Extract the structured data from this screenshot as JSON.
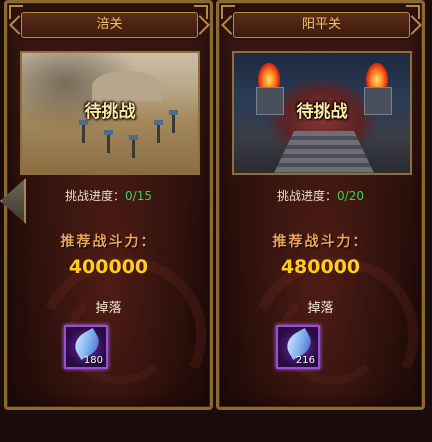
{
  "stages": [
    {
      "title": "涪关",
      "status_label": "待挑战",
      "progress_label": "挑战进度：",
      "progress_value": "0/15",
      "power_label": "推荐战斗力：",
      "power_value": "400000",
      "drop_label": "掉落",
      "drop_item": {
        "icon": "feather-icon",
        "count": "180"
      }
    },
    {
      "title": "阳平关",
      "status_label": "待挑战",
      "progress_label": "挑战进度：",
      "progress_value": "0/20",
      "power_label": "推荐战斗力：",
      "power_value": "480000",
      "drop_label": "掉落",
      "drop_item": {
        "icon": "feather-icon",
        "count": "216"
      }
    }
  ],
  "colors": {
    "progress_green": "#3fd04a",
    "power_gold": "#ffcc22",
    "item_rarity_purple": "#9a4fd0"
  }
}
